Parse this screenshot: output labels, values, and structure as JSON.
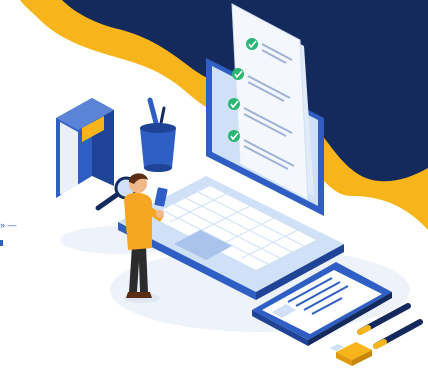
{
  "illustration": {
    "subject": "isometric-checklist-laptop",
    "palette": {
      "navy": "#142a5c",
      "yellow": "#f7b51b",
      "blue": "#2f5fc4",
      "light_blue": "#cfe0f7",
      "paper": "#eef3fb",
      "check_green": "#2bb673",
      "skin": "#f1b98a",
      "hair": "#5a2d17",
      "shirt": "#f6a623",
      "pants": "#2c2c2c",
      "shadow": "#e8eef7"
    },
    "checklist": {
      "item_count": 4,
      "all_checked": true
    },
    "objects": [
      "book-icon",
      "pen-cup-icon",
      "magnifier-icon",
      "laptop-icon",
      "checklist-document",
      "person-with-phone",
      "tablet-icon",
      "pencil-icon",
      "pen-icon",
      "usb-drive-icon"
    ]
  },
  "side_text": {
    "visible_fragment": "»  —"
  }
}
